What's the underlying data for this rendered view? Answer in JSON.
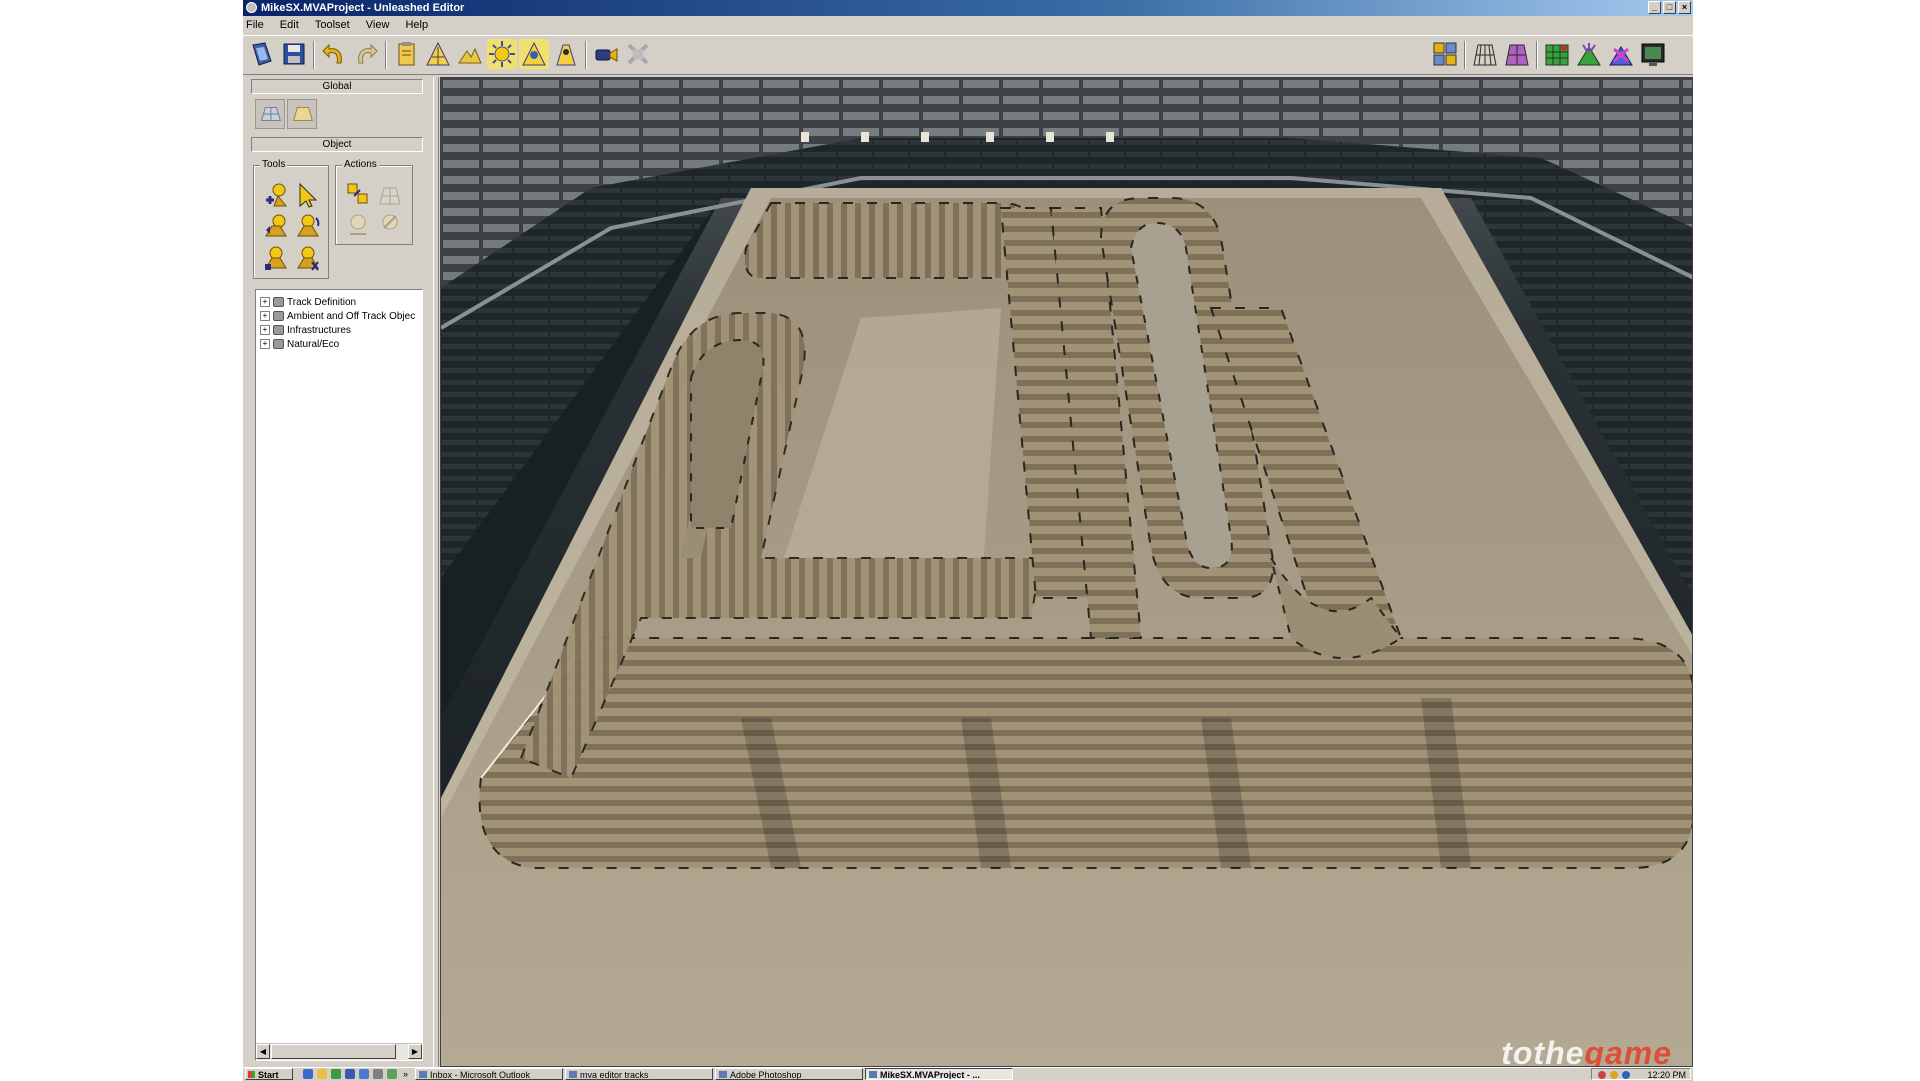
{
  "window": {
    "title": "MikeSX.MVAProject - Unleashed Editor",
    "controls": [
      "_",
      "□",
      "×"
    ]
  },
  "menu": [
    "File",
    "Edit",
    "Toolset",
    "View",
    "Help"
  ],
  "left_panel": {
    "global_header": "Global",
    "object_header": "Object",
    "tools_label": "Tools",
    "actions_label": "Actions",
    "tree": [
      {
        "label": "Track Definition"
      },
      {
        "label": "Ambient and Off Track Objec"
      },
      {
        "label": "Infrastructures"
      },
      {
        "label": "Natural/Eco"
      }
    ]
  },
  "taskbar": {
    "start_label": "Start",
    "overflow": "»",
    "tasks": [
      {
        "label": "Inbox - Microsoft Outlook"
      },
      {
        "label": "mva editor tracks"
      },
      {
        "label": "Adobe Photoshop"
      },
      {
        "label": "MikeSX.MVAProject - ..."
      }
    ],
    "clock": "12:20 PM"
  },
  "watermark": {
    "part1": "tothe",
    "part2": "game"
  },
  "colors": {
    "title_bar": "#0a246a",
    "chrome": "#d4d0c8",
    "dirt": "#a89a7c",
    "stands": "#1f2a2e"
  }
}
